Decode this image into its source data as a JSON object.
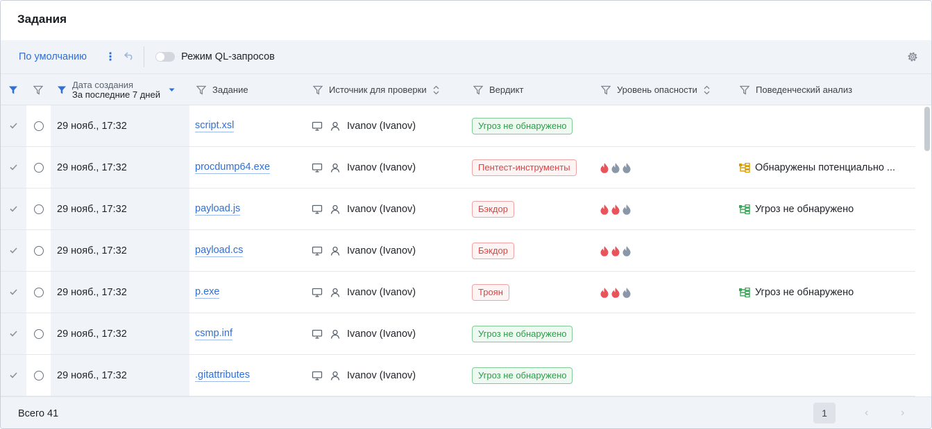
{
  "page": {
    "title": "Задания"
  },
  "toolbar": {
    "preset_label": "По умолчанию",
    "ql_mode_label": "Режим QL-запросов",
    "ql_mode_on": false
  },
  "columns": {
    "created": "Дата создания",
    "created_filter": "За последние 7 дней",
    "task": "Задание",
    "source": "Источник для проверки",
    "verdict": "Вердикт",
    "severity": "Уровень опасности",
    "behavior": "Поведенческий анализ"
  },
  "rows": [
    {
      "date": "29 нояб., 17:32",
      "task": "script.xsl",
      "source": "Ivanov (Ivanov)",
      "verdict": "Угроз не обнаружено",
      "verdict_type": "ok",
      "severity": 0,
      "behavior": "",
      "behavior_type": ""
    },
    {
      "date": "29 нояб., 17:32",
      "task": "procdump64.exe",
      "source": "Ivanov (Ivanov)",
      "verdict": "Пентест-инструменты",
      "verdict_type": "bad",
      "severity": 1,
      "behavior": "Обнаружены потенциально ...",
      "behavior_type": "warn"
    },
    {
      "date": "29 нояб., 17:32",
      "task": "payload.js",
      "source": "Ivanov (Ivanov)",
      "verdict": "Бэкдор",
      "verdict_type": "bad",
      "severity": 2,
      "behavior": "Угроз не обнаружено",
      "behavior_type": "ok"
    },
    {
      "date": "29 нояб., 17:32",
      "task": "payload.cs",
      "source": "Ivanov (Ivanov)",
      "verdict": "Бэкдор",
      "verdict_type": "bad",
      "severity": 2,
      "behavior": "",
      "behavior_type": ""
    },
    {
      "date": "29 нояб., 17:32",
      "task": "p.exe",
      "source": "Ivanov (Ivanov)",
      "verdict": "Троян",
      "verdict_type": "bad",
      "severity": 2,
      "behavior": "Угроз не обнаружено",
      "behavior_type": "ok"
    },
    {
      "date": "29 нояб., 17:32",
      "task": "csmp.inf",
      "source": "Ivanov (Ivanov)",
      "verdict": "Угроз не обнаружено",
      "verdict_type": "ok",
      "severity": 0,
      "behavior": "",
      "behavior_type": ""
    },
    {
      "date": "29 нояб., 17:32",
      "task": ".gitattributes",
      "source": "Ivanov (Ivanov)",
      "verdict": "Угроз не обнаружено",
      "verdict_type": "ok",
      "severity": 0,
      "behavior": "",
      "behavior_type": ""
    }
  ],
  "footer": {
    "total": "Всего 41",
    "current_page": "1"
  },
  "colors": {
    "accent": "#2f6fd6",
    "flame_active": "#e8545a",
    "flame_inactive": "#8a97a8",
    "behavior_warn": "#d89b00",
    "behavior_ok": "#3aa655"
  }
}
